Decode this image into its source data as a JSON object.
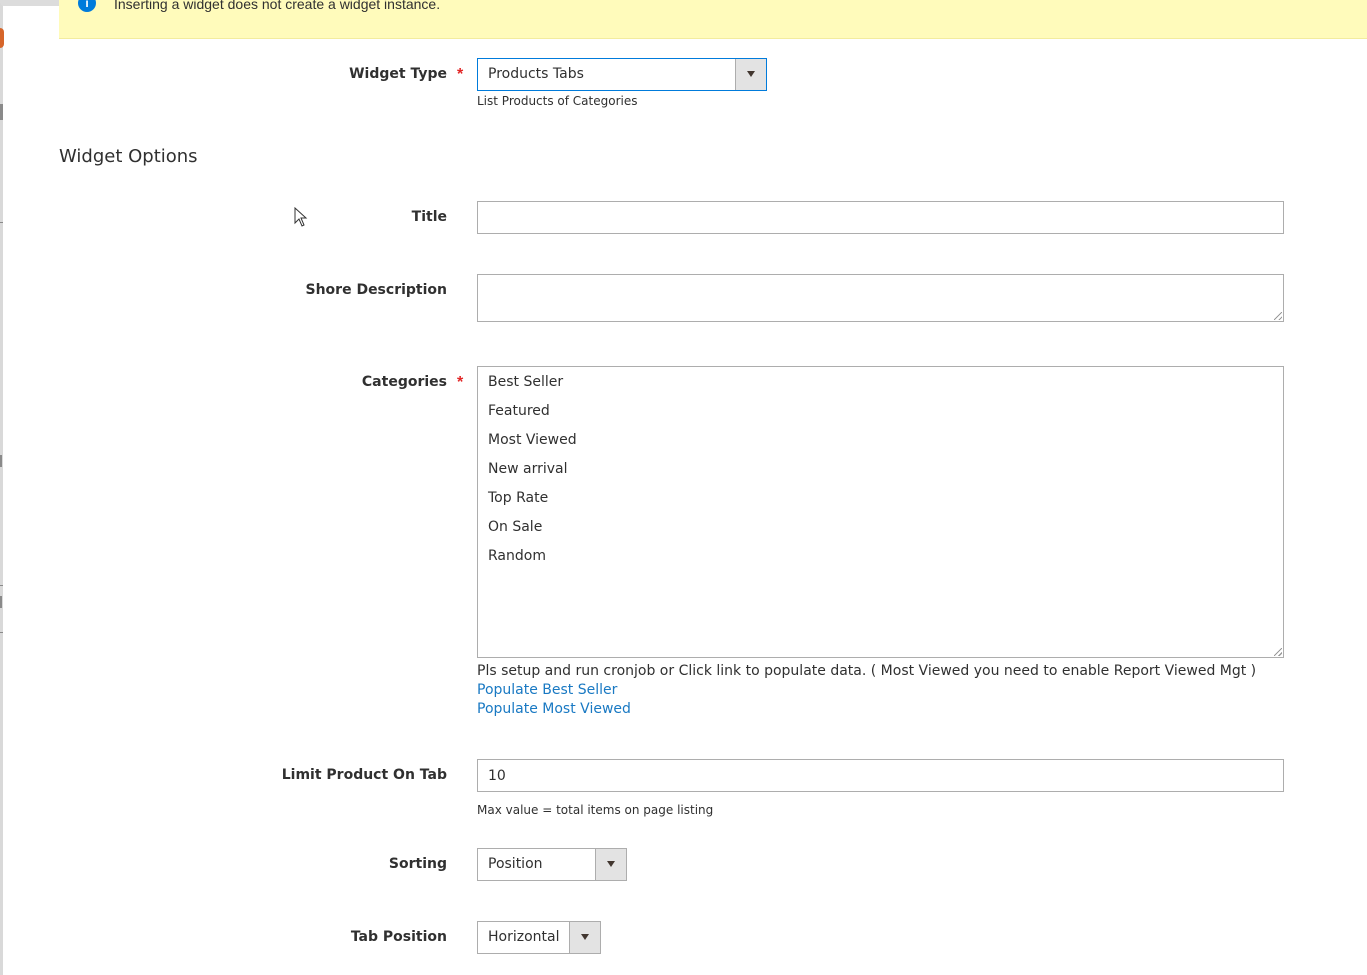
{
  "notice": {
    "text": "Inserting a widget does not create a widget instance.",
    "icon": "info-icon"
  },
  "widget_type": {
    "label": "Widget Type",
    "required_mark": "*",
    "value": "Products Tabs",
    "note": "List Products of Categories"
  },
  "section": {
    "title": "Widget Options"
  },
  "title_field": {
    "label": "Title",
    "value": ""
  },
  "short_description": {
    "label": "Shore Description",
    "value": ""
  },
  "categories": {
    "label": "Categories",
    "required_mark": "*",
    "options": [
      "Best Seller",
      "Featured",
      "Most Viewed",
      "New arrival",
      "Top Rate",
      "On Sale",
      "Random"
    ],
    "help": "Pls setup and run cronjob or Click link to populate data. ( Most Viewed you need to enable Report Viewed Mgt )",
    "links": [
      "Populate Best Seller",
      "Populate Most Viewed"
    ]
  },
  "limit": {
    "label": "Limit Product On Tab",
    "value": "10",
    "note": "Max value = total items on page listing"
  },
  "sorting": {
    "label": "Sorting",
    "value": "Position"
  },
  "tab_position": {
    "label": "Tab Position",
    "value": "Horizontal"
  },
  "colors": {
    "notice_bg": "#fffbbb",
    "link": "#1979c3",
    "required": "#e22626",
    "focus_border": "#007bdb"
  }
}
